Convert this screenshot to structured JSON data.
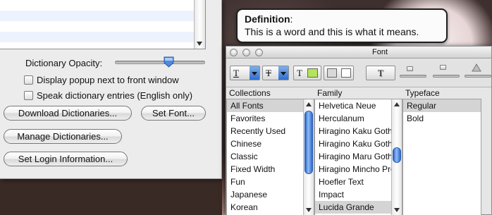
{
  "dictionary_prefs": {
    "opacity_label": "Dictionary Opacity:",
    "opacity_value": 0.6,
    "checkbox_popup_front": "Display popup next to front window",
    "checkbox_speak_entries": "Speak dictionary entries (English only)",
    "download_button": "Download Dictionaries...",
    "set_font_button": "Set Font...",
    "manage_button": "Manage Dictionaries...",
    "login_button": "Set Login Information..."
  },
  "definition_popup": {
    "title": "Definition",
    "colon": ":",
    "text": "This is a word and this is what it means."
  },
  "font_panel": {
    "title": "Font",
    "collections_header": "Collections",
    "family_header": "Family",
    "typeface_header": "Typeface",
    "collections": [
      "All Fonts",
      "Favorites",
      "Recently Used",
      "Chinese",
      "Classic",
      "Fixed Width",
      "Fun",
      "Japanese",
      "Korean"
    ],
    "families": [
      "Helvetica Neue",
      "Herculanum",
      "Hiragino Kaku Gothic",
      "Hiragino Kaku Gothic",
      "Hiragino Maru Gothic",
      "Hiragino Mincho Pro",
      "Hoefler Text",
      "Impact",
      "Lucida Grande"
    ],
    "typefaces": [
      "Regular",
      "Bold"
    ],
    "selected_collection": "All Fonts",
    "selected_family": "Lucida Grande",
    "selected_typeface": "Regular",
    "text_color": "#2a2a2a",
    "document_color": "#b5e35a",
    "glyph_underline": "T",
    "glyph_strike": "T",
    "glyph_color": "T",
    "glyph_shadow": "T"
  },
  "colors": {
    "accent_blue": "#2f6ed1",
    "panel_bg": "#ececec",
    "selection_gray": "#d4d4d4"
  }
}
